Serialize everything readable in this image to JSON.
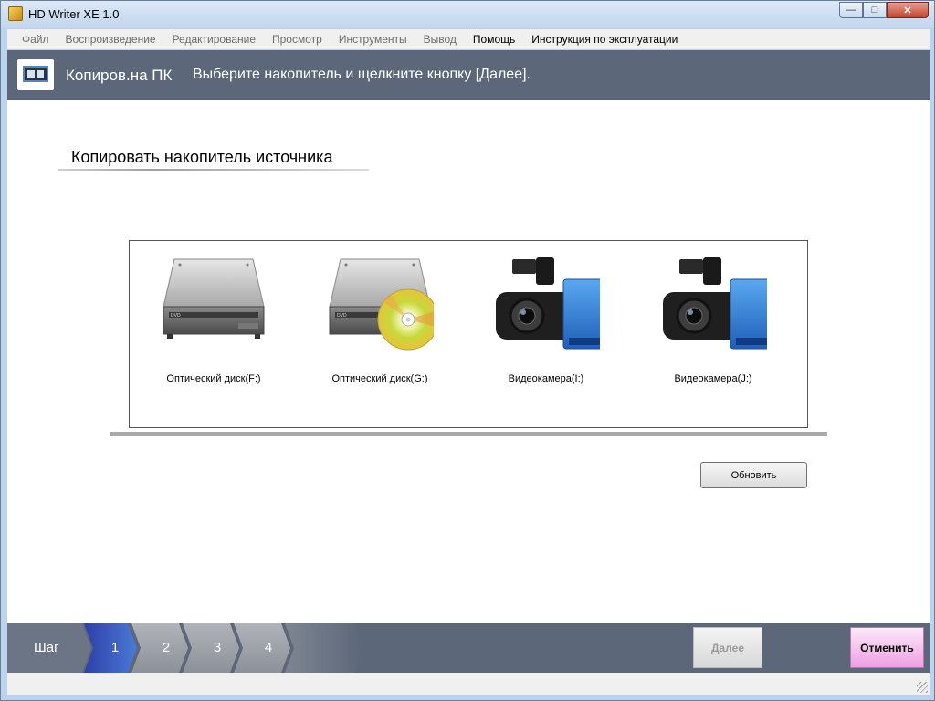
{
  "window": {
    "title": "HD Writer XE 1.0",
    "controls": {
      "minimize": "—",
      "maximize": "□",
      "close": "✕"
    }
  },
  "menu": [
    {
      "label": "Файл",
      "active": false
    },
    {
      "label": "Воспроизведение",
      "active": false
    },
    {
      "label": "Редактирование",
      "active": false
    },
    {
      "label": "Просмотр",
      "active": false
    },
    {
      "label": "Инструменты",
      "active": false
    },
    {
      "label": "Вывод",
      "active": false
    },
    {
      "label": "Помощь",
      "active": true
    },
    {
      "label": "Инструкция по эксплуатации",
      "active": true
    }
  ],
  "header": {
    "title": "Копиров.на ПК",
    "instruction": "Выберите накопитель и щелкните кнопку [Далее]."
  },
  "section": {
    "title": "Копировать накопитель источника"
  },
  "drives": [
    {
      "label": "Оптический диск(F:)",
      "icon": "optical-drive-icon"
    },
    {
      "label": "Оптический диск(G:)",
      "icon": "optical-drive-with-disc-icon"
    },
    {
      "label": "Видеокамера(I:)",
      "icon": "camcorder-sd-card-icon"
    },
    {
      "label": "Видеокамера(J:)",
      "icon": "camcorder-sd-card-icon"
    }
  ],
  "refresh_button": "Обновить",
  "footer": {
    "step_label": "Шаг",
    "steps": [
      "1",
      "2",
      "3",
      "4"
    ],
    "current_step": "1",
    "next_button": "Далее",
    "cancel_button": "Отменить"
  },
  "colors": {
    "header_bg": "#5c6779",
    "active_step": "#3d57b8",
    "cancel_bg": "#ef9fe4"
  }
}
